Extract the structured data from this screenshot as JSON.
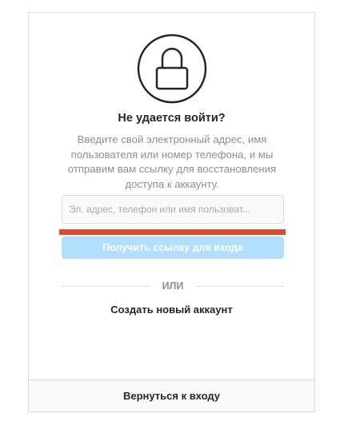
{
  "header": {
    "title": "Не удается войти?",
    "description": "Введите свой электронный адрес, имя пользователя или номер телефона, и мы отправим вам ссылку для восстановления доступа к аккаунту."
  },
  "form": {
    "input_placeholder": "Эл. адрес, телефон или имя пользоват...",
    "input_value": "",
    "submit_label": "Получить ссылку для входа"
  },
  "divider": {
    "label": "ИЛИ"
  },
  "links": {
    "create_account": "Создать новый аккаунт",
    "back_to_login": "Вернуться к входу"
  },
  "icons": {
    "lock": "lock-icon"
  },
  "colors": {
    "button_disabled": "#b2dffc",
    "highlight_bar": "#e04a2a",
    "text_primary": "#262626",
    "text_secondary": "#8e8e8e",
    "border": "#dbdbdb"
  }
}
